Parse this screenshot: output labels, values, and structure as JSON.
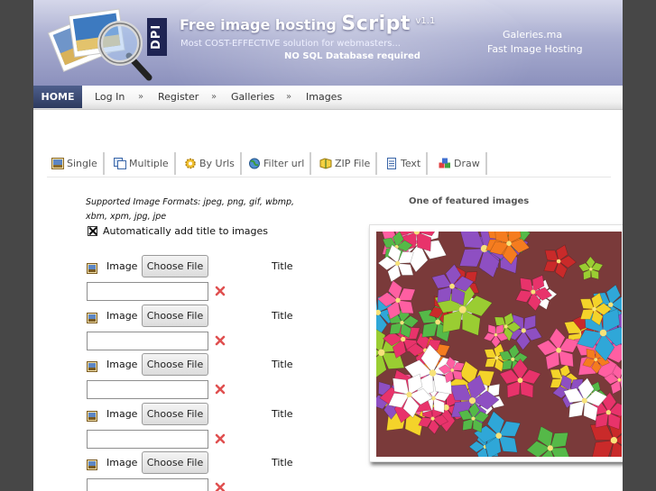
{
  "header": {
    "logo_badge": "DPI",
    "title_part1": "Free image hosting",
    "title_part2": "Script",
    "version": "v1.1",
    "tagline": "Most COST-EFFECTIVE solution for webmasters...",
    "nosql": "NO SQL Database required",
    "site_name": "Galeries.ma",
    "site_subtitle": "Fast Image Hosting"
  },
  "nav": {
    "home": "HOME",
    "separator": "»",
    "items": [
      "Log In",
      "Register",
      "Galleries",
      "Images"
    ]
  },
  "tabs": [
    {
      "label": "Single",
      "icon": "single-upload-icon"
    },
    {
      "label": "Multiple",
      "icon": "multiple-upload-icon"
    },
    {
      "label": "By Urls",
      "icon": "gear-icon"
    },
    {
      "label": "Filter url",
      "icon": "globe-icon"
    },
    {
      "label": "ZIP File",
      "icon": "zip-icon"
    },
    {
      "label": "Text",
      "icon": "document-icon"
    },
    {
      "label": "Draw",
      "icon": "draw-icon"
    }
  ],
  "form": {
    "formats_text": "Supported Image Formats: jpeg, png, gif, wbmp, xbm, xpm, jpg, jpe",
    "auto_title_label": "Automatically add title to images",
    "auto_title_checked": true,
    "rows": [
      {
        "image_label": "Image",
        "button_label": "Choose File",
        "title_label": "Title",
        "title_value": ""
      },
      {
        "image_label": "Image",
        "button_label": "Choose File",
        "title_label": "Title",
        "title_value": ""
      },
      {
        "image_label": "Image",
        "button_label": "Choose File",
        "title_label": "Title",
        "title_value": ""
      },
      {
        "image_label": "Image",
        "button_label": "Choose File",
        "title_label": "Title",
        "title_value": ""
      },
      {
        "image_label": "Image",
        "button_label": "Choose File",
        "title_label": "Title",
        "title_value": ""
      }
    ]
  },
  "featured": {
    "caption": "One of featured images"
  },
  "colors": {
    "page_bg": "#474747",
    "header_accent": "#8c91bd",
    "nav_home_bg": "#2d3a5e",
    "remove_red": "#e05050"
  }
}
